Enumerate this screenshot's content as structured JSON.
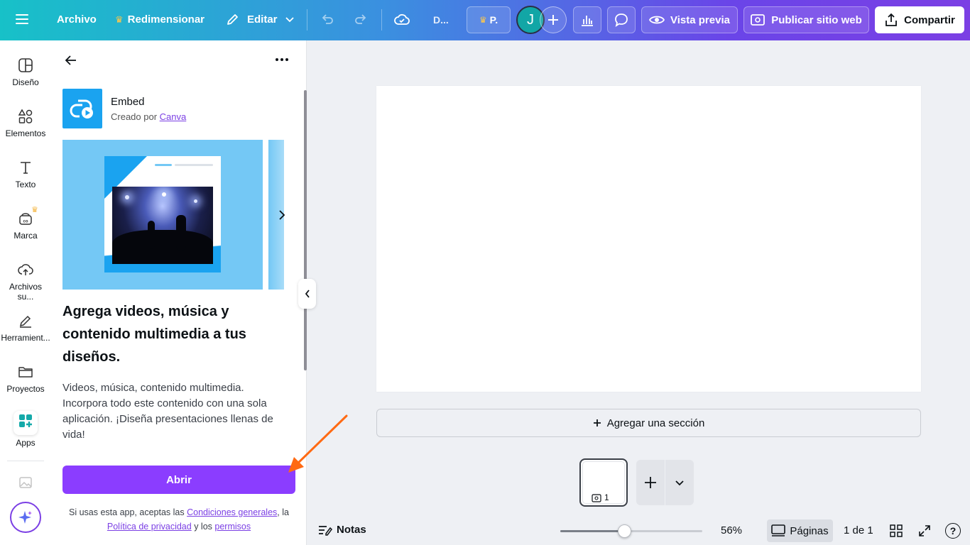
{
  "topbar": {
    "archivo": "Archivo",
    "redimensionar": "Redimensionar",
    "editar": "Editar",
    "doc_title": "D...",
    "plan_badge": "P.",
    "avatar_initial": "J",
    "vista_previa": "Vista previa",
    "publicar": "Publicar sitio web",
    "compartir": "Compartir"
  },
  "rail": {
    "items": [
      {
        "label": "Diseño",
        "icon": "layout-icon"
      },
      {
        "label": "Elementos",
        "icon": "shapes-icon"
      },
      {
        "label": "Texto",
        "icon": "text-icon"
      },
      {
        "label": "Marca",
        "icon": "brand-icon"
      },
      {
        "label": "Archivos su...",
        "icon": "cloud-upload-icon"
      },
      {
        "label": "Herramient...",
        "icon": "pen-tool-icon"
      },
      {
        "label": "Proyectos",
        "icon": "folder-icon"
      },
      {
        "label": "Apps",
        "icon": "apps-icon"
      }
    ]
  },
  "panel": {
    "app_name": "Embed",
    "created_by_prefix": "Creado por",
    "creator": "Canva",
    "headline": "Agrega videos, música y contenido multimedia a tus diseños.",
    "description": "Videos, música, contenido multimedia. Incorpora todo este contenido con una sola aplicación. ¡Diseña presentaciones llenas de vida!",
    "open_button": "Abrir",
    "terms_prefix": "Si usas esta app, aceptas las",
    "terms_link": "Condiciones generales",
    "terms_mid": ", la",
    "privacy_link": "Política de privacidad",
    "terms_and": "y los",
    "permissions_link": "permisos"
  },
  "canvas": {
    "add_section": "Agregar una sección",
    "page_number": "1"
  },
  "bottom": {
    "notes": "Notas",
    "zoom": "56%",
    "zoom_fraction": 0.45,
    "pages": "Páginas",
    "page_count": "1 de 1"
  },
  "colors": {
    "accent": "#8b3dff",
    "panel_blue": "#74c8f5",
    "icon_blue": "#1aa3f0"
  }
}
